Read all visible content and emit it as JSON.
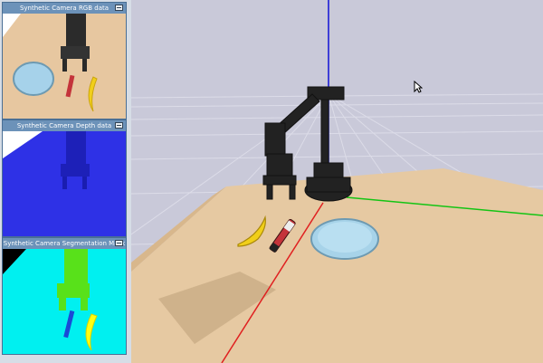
{
  "panels": {
    "rgb": {
      "title": "Synthetic Camera RGB data"
    },
    "depth": {
      "title": "Synthetic Camera Depth data"
    },
    "segmentation": {
      "title": "Synthetic Camera Segmentation Mask"
    }
  },
  "scene": {
    "background_color": "#c9c9d9",
    "table_color": "#e6c9a2",
    "plate_color": "#a7d3e9",
    "axis_colors": {
      "x": "#e02020",
      "y": "#14c414",
      "z": "#1b1bd6"
    }
  }
}
